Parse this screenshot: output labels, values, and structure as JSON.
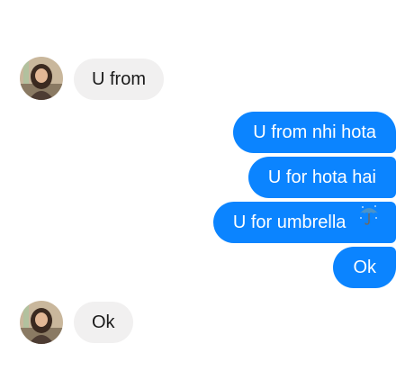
{
  "messages": [
    {
      "side": "incoming",
      "text": "U from"
    },
    {
      "side": "outgoing",
      "text": "U from nhi hota"
    },
    {
      "side": "outgoing",
      "text": "U for hota hai"
    },
    {
      "side": "outgoing",
      "text": "U for umbrella",
      "emoji": "umbrella-with-rain-icon"
    },
    {
      "side": "outgoing",
      "text": "Ok"
    },
    {
      "side": "incoming",
      "text": "Ok"
    }
  ],
  "colors": {
    "outgoing_bubble": "#0b84ff",
    "incoming_bubble": "#f1f0f0",
    "outgoing_text": "#ffffff",
    "incoming_text": "#1a1a1a"
  }
}
